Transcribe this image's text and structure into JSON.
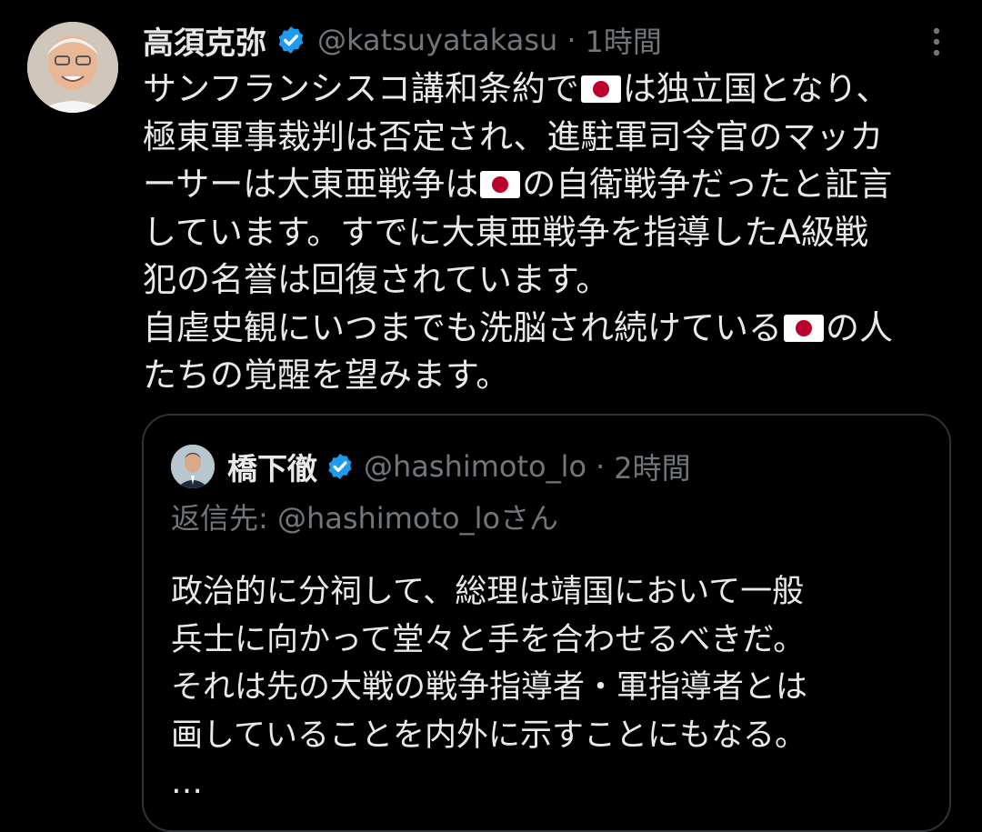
{
  "tweet": {
    "author_name": "高須克弥",
    "handle": "@katsuyatakasu",
    "separator": "·",
    "time": "1時間",
    "lines": [
      [
        "サンフランシスコ講和条約で",
        "flag",
        "は独立国となり、"
      ],
      [
        "極東軍事裁判は否定され、進駐軍司令官のマッカ"
      ],
      [
        "ーサーは大東亜戦争は",
        "flag",
        "の自衛戦争だったと証言"
      ],
      [
        "しています。すでに大東亜戦争を指導したA級戦"
      ],
      [
        "犯の名誉は回復されています。"
      ],
      [
        "自虐史観にいつまでも洗脳され続けている",
        "flag",
        "の人"
      ],
      [
        "たちの覚醒を望みます。"
      ]
    ]
  },
  "quoted_tweet": {
    "author_name": "橋下徹",
    "handle": "@hashimoto_lo",
    "separator": "·",
    "time": "2時間",
    "reply_to": "返信先: @hashimoto_loさん",
    "lines": [
      "政治的に分祠して、総理は靖国において一般",
      "兵士に向かって堂々と手を合わせるべきだ。",
      "それは先の大戦の戦争指導者・軍指導者とは",
      "画していることを内外に示すことにもなる。",
      "…"
    ]
  },
  "icons": {
    "verified": "verified-badge-icon",
    "more": "more-options-icon",
    "flag": "japan-flag-emoji"
  },
  "colors": {
    "background": "#000000",
    "text": "#e7e9ea",
    "muted": "#71767b",
    "verified": "#1d9bf0",
    "border": "#2f3336"
  }
}
